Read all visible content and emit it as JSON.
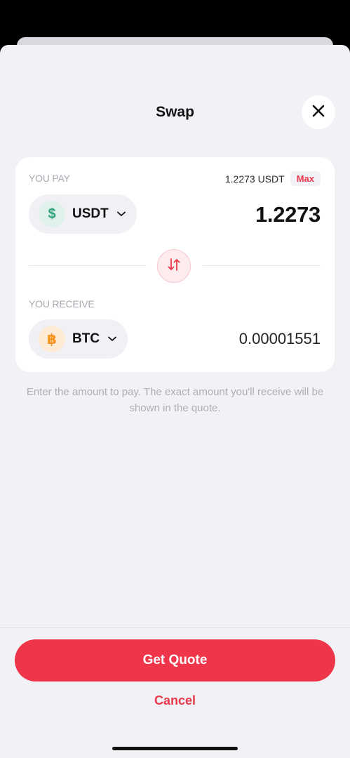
{
  "header": {
    "title": "Swap"
  },
  "pay": {
    "label": "YOU PAY",
    "balance": "1.2273 USDT",
    "max_label": "Max",
    "token": {
      "symbol": "USDT",
      "icon": "dollar-icon",
      "color": "#2fa37c"
    },
    "amount": "1.2273"
  },
  "receive": {
    "label": "YOU RECEIVE",
    "token": {
      "symbol": "BTC",
      "icon": "bitcoin-icon",
      "color": "#f7931a"
    },
    "amount": "0.00001551"
  },
  "hint": "Enter the amount to pay. The exact amount you'll receive will be shown in the quote.",
  "actions": {
    "primary": "Get Quote",
    "secondary": "Cancel"
  },
  "colors": {
    "accent": "#ee3549",
    "background": "#f1f1f6"
  }
}
